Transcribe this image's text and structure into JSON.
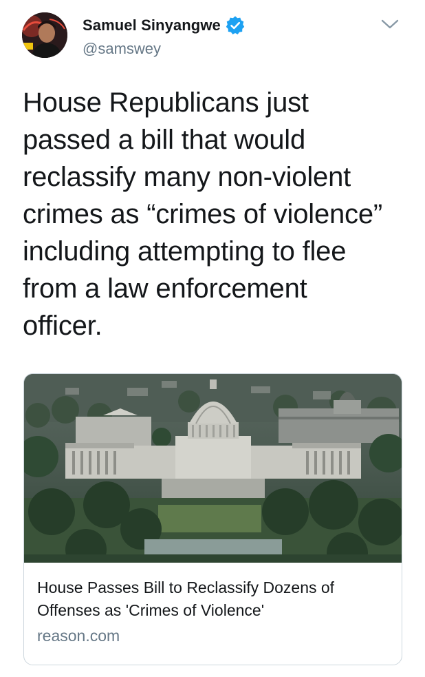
{
  "tweet": {
    "author": {
      "display_name": "Samuel Sinyangwe",
      "handle": "@samswey",
      "verified": true,
      "verified_color": "#1da1f2"
    },
    "text_lines": [
      "House Republicans just",
      "passed a bill that would",
      "reclassify many non-violent",
      "crimes as “crimes of violence”",
      "including attempting to flee",
      "from a law enforcement",
      "officer."
    ],
    "link_card": {
      "title": "House Passes Bill to Reclassify Dozens of Offenses as 'Crimes of Violence'",
      "domain": "reason.com",
      "image_icon": "us-capitol-aerial-photo"
    }
  },
  "icons": {
    "menu": "chevron-down-icon",
    "verified": "verified-badge-icon"
  },
  "colors": {
    "text": "#14171a",
    "secondary": "#657786",
    "border": "#ccd6dd",
    "accent": "#1da1f2"
  }
}
